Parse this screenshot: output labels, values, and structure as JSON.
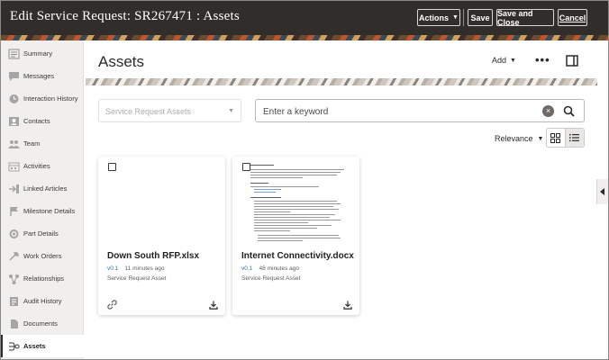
{
  "header": {
    "title": "Edit Service Request: SR267471 : Assets",
    "actions_label": "Actions",
    "save_label": "Save",
    "save_close_label": "Save and Close",
    "cancel_label": "Cancel"
  },
  "sidebar": {
    "items": [
      {
        "label": "Summary",
        "icon": "summary-icon"
      },
      {
        "label": "Messages",
        "icon": "messages-icon"
      },
      {
        "label": "Interaction History",
        "icon": "interaction-history-icon"
      },
      {
        "label": "Contacts",
        "icon": "contacts-icon"
      },
      {
        "label": "Team",
        "icon": "team-icon"
      },
      {
        "label": "Activities",
        "icon": "activities-icon"
      },
      {
        "label": "Linked Articles",
        "icon": "linked-articles-icon"
      },
      {
        "label": "Milestone Details",
        "icon": "milestone-icon"
      },
      {
        "label": "Part Details",
        "icon": "part-details-icon"
      },
      {
        "label": "Work Orders",
        "icon": "work-orders-icon"
      },
      {
        "label": "Relationships",
        "icon": "relationships-icon"
      },
      {
        "label": "Audit History",
        "icon": "audit-history-icon"
      },
      {
        "label": "Documents",
        "icon": "documents-icon"
      },
      {
        "label": "Assets",
        "icon": "assets-icon",
        "active": true
      }
    ]
  },
  "main": {
    "title": "Assets",
    "add_label": "Add",
    "more_label": "•••",
    "filter_placeholder": "Service Request Assets",
    "search_placeholder": "Enter a keyword",
    "sort_label": "Relevance"
  },
  "cards": [
    {
      "name": "Down South RFP.xlsx",
      "version": "v0.1",
      "time": "11 minutes ago",
      "type": "Service Request Asset"
    },
    {
      "name": "Internet Connectivity.docx",
      "version": "v0.1",
      "time": "48 minutes ago",
      "type": "Service Request Asset"
    }
  ]
}
